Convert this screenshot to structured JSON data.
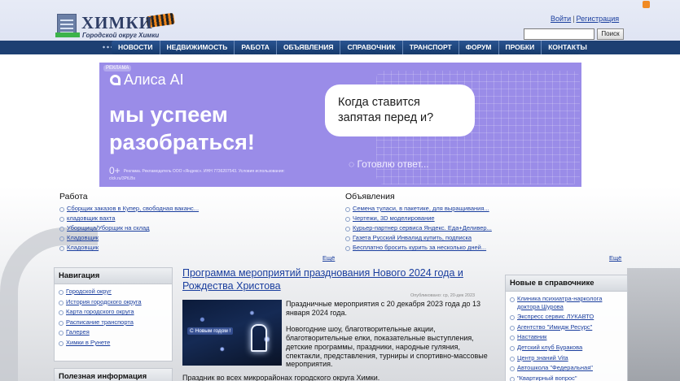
{
  "header": {
    "logo_title": "ХИМКИ",
    "logo_subtitle": "Городской округ Химки",
    "login": "Войти",
    "separator": "|",
    "register": "Регистрация",
    "search_placeholder": "",
    "search_button": "Поиск"
  },
  "nav": [
    "НОВОСТИ",
    "НЕДВИЖИМОСТЬ",
    "РАБОТА",
    "ОБЪЯВЛЕНИЯ",
    "СПРАВОЧНИК",
    "ТРАНСПОРТ",
    "ФОРУМ",
    "ПРОБКИ",
    "КОНТАКТЫ"
  ],
  "ad": {
    "tag": "РЕКЛАМА",
    "brand": "Алиса AI",
    "slogan": "мы успеем разобраться!",
    "legal": "Реклама. Рекламодатель ООО «Яндекс». ИНН 7736207543. Условия использования: clck.ru/3PtLBs",
    "question": "Когда ставится запятая перед и?",
    "answer": "Готовлю ответ..."
  },
  "jobs": {
    "title": "Работа",
    "items": [
      "Сборщик заказов в Купер, свободная ваканс...",
      "кладовщик вахта",
      "Уборщица/Уборщик на склад",
      "Кладовщик",
      "Кладовщик"
    ],
    "more": "Ещё"
  },
  "ads_list": {
    "title": "Объявления",
    "items": [
      "Семена туласи, в пакетике, для выращивания...",
      "Чертежи, 3D моделирование",
      "Курьер-партнер сервиса Яндекс. Еда+Деливер...",
      "Газета Русский Инвалид купить, подписка",
      "Бесплатно бросить курить за несколько дней..."
    ],
    "more": "Ещё"
  },
  "navigation": {
    "title": "Навигация",
    "items": [
      "Городской округ",
      "История городского округа",
      "Карта городского округа",
      "Расписание транспорта",
      "Галерея",
      "Химки в Рунете"
    ]
  },
  "useful_info": {
    "title": "Полезная информация"
  },
  "directory": {
    "title": "Новые в справочнике",
    "items": [
      "Клиника психиатра-нарколога доктора Шурова",
      "Экспресс сервис ЛУКАВТО",
      "Агентство \"Имидж Ресурс\"",
      "Наставник",
      "Детский клуб Буракова",
      "Центр знаний Vita",
      "Автошкола \"Федеральная\"",
      "\"Квартирный вопрос\""
    ]
  },
  "article": {
    "title": "Программа мероприятий празднования Нового 2024 года и Рождества Христова",
    "date": "Опубликовано: ср, 20-дек 2023",
    "image_caption": "С Новым годом !",
    "p1": "Праздничные мероприятия с 20 декабря 2023 года до 13 января 2024 года.",
    "p2": "Новогодние шоу, благотворительные акции, благотворительные елки, показательные выступления, детские программы, праздники, народные гуляния, спектакли, представления, турниры и спортивно-массовые мероприятия.",
    "p3": "Праздник во всех микрорайонах городского округа Химки."
  }
}
